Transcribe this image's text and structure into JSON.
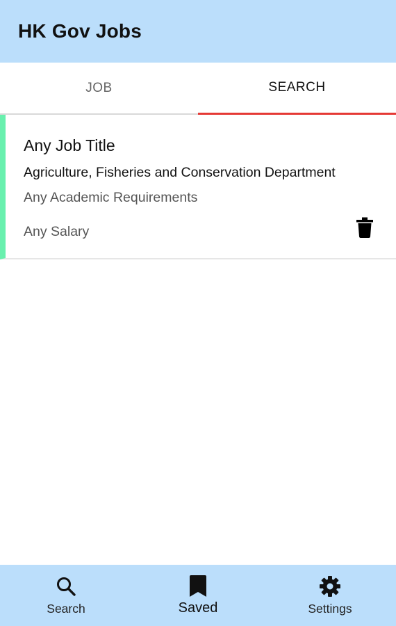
{
  "appbar": {
    "title": "HK Gov Jobs"
  },
  "tabs": [
    {
      "label": "JOB",
      "active": false
    },
    {
      "label": "SEARCH",
      "active": true
    }
  ],
  "search_card": {
    "job_title": "Any Job Title",
    "department": "Agriculture, Fisheries and Conservation Department",
    "academic": "Any Academic Requirements",
    "salary": "Any Salary",
    "delete_icon": "trash-icon",
    "accent_color": "#69f0ae"
  },
  "bottom_nav": [
    {
      "label": "Search",
      "icon": "search-icon",
      "active": false
    },
    {
      "label": "Saved",
      "icon": "bookmark-icon",
      "active": true
    },
    {
      "label": "Settings",
      "icon": "gear-icon",
      "active": false
    }
  ],
  "colors": {
    "bar_background": "#bbdefb",
    "tab_indicator": "#e53935"
  }
}
